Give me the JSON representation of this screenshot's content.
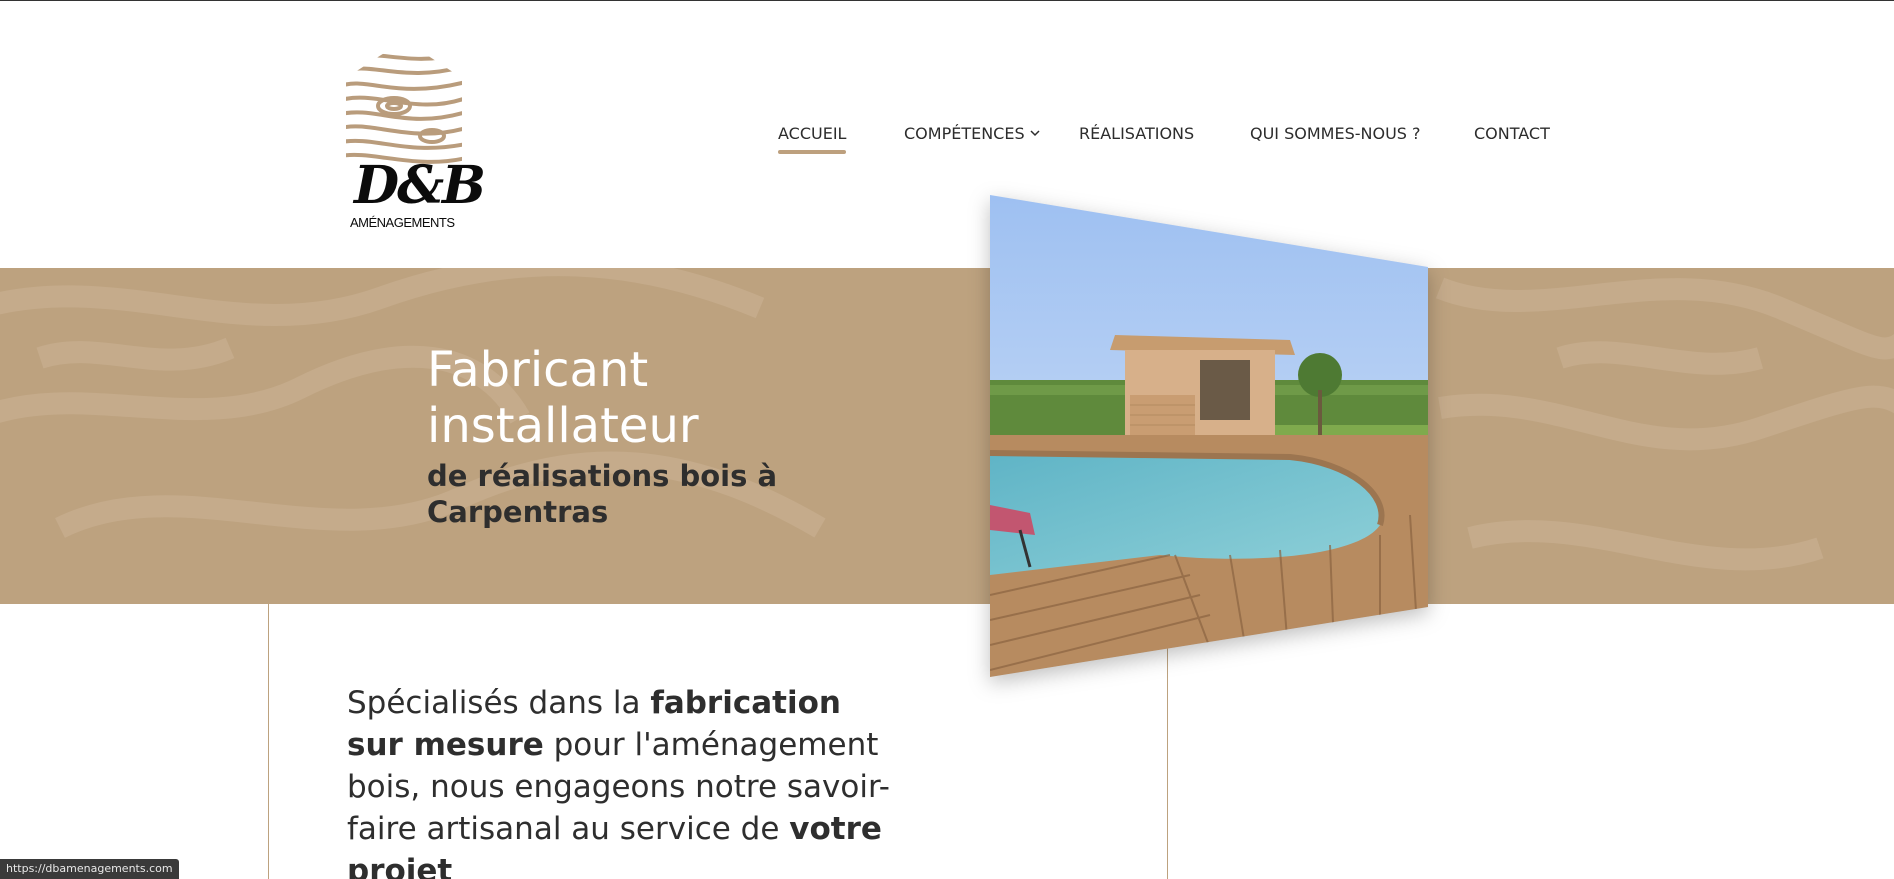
{
  "logo": {
    "letters": "D&B",
    "subtitle": "AMÉNAGEMENTS",
    "colors": {
      "wood": "#b99c7c",
      "text": "#0b0b0b"
    }
  },
  "nav": {
    "items": [
      {
        "label": "ACCUEIL",
        "active": true
      },
      {
        "label": "COMPÉTENCES",
        "has_dropdown": true
      },
      {
        "label": "RÉALISATIONS"
      },
      {
        "label": "QUI SOMMES-NOUS ?"
      },
      {
        "label": "CONTACT"
      }
    ],
    "accent": "#bda07e"
  },
  "hero": {
    "title": "Fabricant installateur",
    "subtitle": "de réalisations bois à Carpentras",
    "background": "#bda27f",
    "photo_alt": "Piscine avec terrasse en bois et pool house"
  },
  "intro": {
    "part1": "Spécialisés dans la ",
    "bold1": "fabrication sur mesure",
    "part2": " pour l'aménagement bois, nous engageons notre savoir-faire artisanal au service de ",
    "bold2": "votre projet"
  },
  "status_bar": {
    "url": "https://dbamenagements.com"
  }
}
